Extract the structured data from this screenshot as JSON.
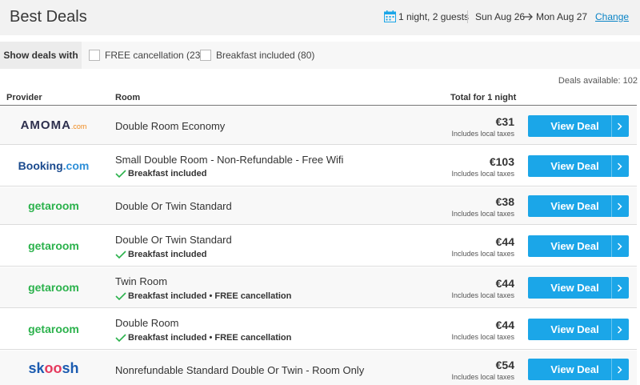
{
  "header": {
    "title": "Best Deals",
    "guests": "1 night, 2 guests",
    "checkin": "Sun Aug 26",
    "checkout": "Mon Aug 27",
    "change_label": "Change"
  },
  "filters": {
    "label": "Show deals with",
    "options": [
      {
        "label": "FREE cancellation (23)",
        "checked": false
      },
      {
        "label": "Breakfast included (80)",
        "checked": false
      }
    ]
  },
  "deals_available": "Deals available: 102",
  "table": {
    "columns": {
      "provider": "Provider",
      "room": "Room",
      "total": "Total for 1 night"
    },
    "taxes_note": "Includes local taxes",
    "button_label": "View Deal",
    "rows": [
      {
        "provider": "AMOMA.com",
        "logo_main": "AMOMA",
        "logo_suffix": ".com",
        "room": "Double Room Economy",
        "extras": "",
        "price": "€31"
      },
      {
        "provider": "Booking.com",
        "logo_main": "Booking",
        "logo_suffix": ".com",
        "room": "Small Double Room - Non-Refundable - Free Wifi",
        "extras": "Breakfast included",
        "price": "€103"
      },
      {
        "provider": "getaroom",
        "room": "Double Or Twin Standard",
        "extras": "",
        "price": "€38"
      },
      {
        "provider": "getaroom",
        "room": "Double Or Twin Standard",
        "extras": "Breakfast included",
        "price": "€44"
      },
      {
        "provider": "getaroom",
        "room": "Twin Room",
        "extras": "Breakfast included • FREE cancellation",
        "price": "€44"
      },
      {
        "provider": "getaroom",
        "room": "Double Room",
        "extras": "Breakfast included • FREE cancellation",
        "price": "€44"
      },
      {
        "provider": "skoosh",
        "logo_main": "sk",
        "logo_mid": "oo",
        "logo_end": "sh",
        "room": "Nonrefundable Standard Double Or Twin - Room Only",
        "extras": "",
        "price": "€54"
      }
    ]
  },
  "colors": {
    "accent": "#1ba6e8",
    "link": "#0a84c6",
    "check": "#2bb24c",
    "header_bg": "#f2f2f2"
  },
  "icons": {
    "calendar": "calendar-icon",
    "arrow": "arrow-right-icon",
    "check": "check-icon",
    "chevron": "chevron-right-icon"
  }
}
